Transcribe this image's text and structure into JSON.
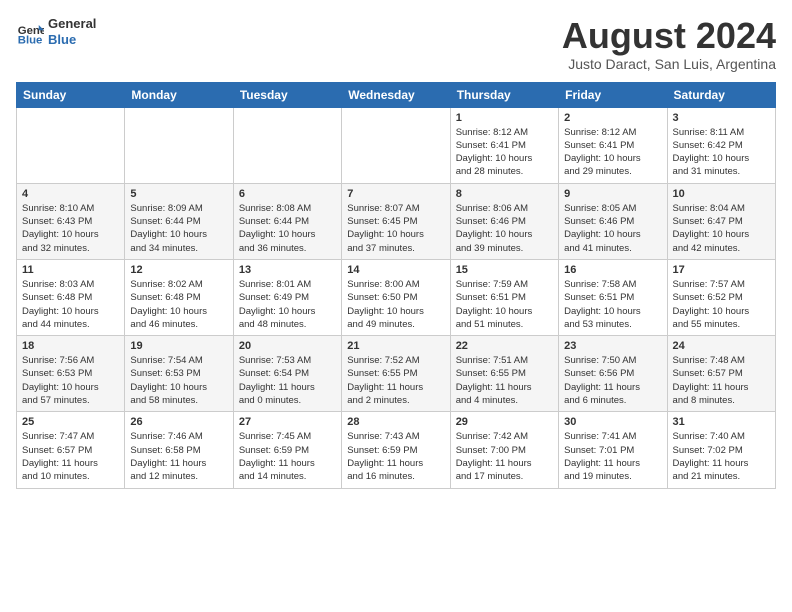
{
  "header": {
    "logo": {
      "line1": "General",
      "line2": "Blue"
    },
    "title": "August 2024",
    "location": "Justo Daract, San Luis, Argentina"
  },
  "weekdays": [
    "Sunday",
    "Monday",
    "Tuesday",
    "Wednesday",
    "Thursday",
    "Friday",
    "Saturday"
  ],
  "weeks": [
    [
      {
        "day": "",
        "info": ""
      },
      {
        "day": "",
        "info": ""
      },
      {
        "day": "",
        "info": ""
      },
      {
        "day": "",
        "info": ""
      },
      {
        "day": "1",
        "info": "Sunrise: 8:12 AM\nSunset: 6:41 PM\nDaylight: 10 hours\nand 28 minutes."
      },
      {
        "day": "2",
        "info": "Sunrise: 8:12 AM\nSunset: 6:41 PM\nDaylight: 10 hours\nand 29 minutes."
      },
      {
        "day": "3",
        "info": "Sunrise: 8:11 AM\nSunset: 6:42 PM\nDaylight: 10 hours\nand 31 minutes."
      }
    ],
    [
      {
        "day": "4",
        "info": "Sunrise: 8:10 AM\nSunset: 6:43 PM\nDaylight: 10 hours\nand 32 minutes."
      },
      {
        "day": "5",
        "info": "Sunrise: 8:09 AM\nSunset: 6:44 PM\nDaylight: 10 hours\nand 34 minutes."
      },
      {
        "day": "6",
        "info": "Sunrise: 8:08 AM\nSunset: 6:44 PM\nDaylight: 10 hours\nand 36 minutes."
      },
      {
        "day": "7",
        "info": "Sunrise: 8:07 AM\nSunset: 6:45 PM\nDaylight: 10 hours\nand 37 minutes."
      },
      {
        "day": "8",
        "info": "Sunrise: 8:06 AM\nSunset: 6:46 PM\nDaylight: 10 hours\nand 39 minutes."
      },
      {
        "day": "9",
        "info": "Sunrise: 8:05 AM\nSunset: 6:46 PM\nDaylight: 10 hours\nand 41 minutes."
      },
      {
        "day": "10",
        "info": "Sunrise: 8:04 AM\nSunset: 6:47 PM\nDaylight: 10 hours\nand 42 minutes."
      }
    ],
    [
      {
        "day": "11",
        "info": "Sunrise: 8:03 AM\nSunset: 6:48 PM\nDaylight: 10 hours\nand 44 minutes."
      },
      {
        "day": "12",
        "info": "Sunrise: 8:02 AM\nSunset: 6:48 PM\nDaylight: 10 hours\nand 46 minutes."
      },
      {
        "day": "13",
        "info": "Sunrise: 8:01 AM\nSunset: 6:49 PM\nDaylight: 10 hours\nand 48 minutes."
      },
      {
        "day": "14",
        "info": "Sunrise: 8:00 AM\nSunset: 6:50 PM\nDaylight: 10 hours\nand 49 minutes."
      },
      {
        "day": "15",
        "info": "Sunrise: 7:59 AM\nSunset: 6:51 PM\nDaylight: 10 hours\nand 51 minutes."
      },
      {
        "day": "16",
        "info": "Sunrise: 7:58 AM\nSunset: 6:51 PM\nDaylight: 10 hours\nand 53 minutes."
      },
      {
        "day": "17",
        "info": "Sunrise: 7:57 AM\nSunset: 6:52 PM\nDaylight: 10 hours\nand 55 minutes."
      }
    ],
    [
      {
        "day": "18",
        "info": "Sunrise: 7:56 AM\nSunset: 6:53 PM\nDaylight: 10 hours\nand 57 minutes."
      },
      {
        "day": "19",
        "info": "Sunrise: 7:54 AM\nSunset: 6:53 PM\nDaylight: 10 hours\nand 58 minutes."
      },
      {
        "day": "20",
        "info": "Sunrise: 7:53 AM\nSunset: 6:54 PM\nDaylight: 11 hours\nand 0 minutes."
      },
      {
        "day": "21",
        "info": "Sunrise: 7:52 AM\nSunset: 6:55 PM\nDaylight: 11 hours\nand 2 minutes."
      },
      {
        "day": "22",
        "info": "Sunrise: 7:51 AM\nSunset: 6:55 PM\nDaylight: 11 hours\nand 4 minutes."
      },
      {
        "day": "23",
        "info": "Sunrise: 7:50 AM\nSunset: 6:56 PM\nDaylight: 11 hours\nand 6 minutes."
      },
      {
        "day": "24",
        "info": "Sunrise: 7:48 AM\nSunset: 6:57 PM\nDaylight: 11 hours\nand 8 minutes."
      }
    ],
    [
      {
        "day": "25",
        "info": "Sunrise: 7:47 AM\nSunset: 6:57 PM\nDaylight: 11 hours\nand 10 minutes."
      },
      {
        "day": "26",
        "info": "Sunrise: 7:46 AM\nSunset: 6:58 PM\nDaylight: 11 hours\nand 12 minutes."
      },
      {
        "day": "27",
        "info": "Sunrise: 7:45 AM\nSunset: 6:59 PM\nDaylight: 11 hours\nand 14 minutes."
      },
      {
        "day": "28",
        "info": "Sunrise: 7:43 AM\nSunset: 6:59 PM\nDaylight: 11 hours\nand 16 minutes."
      },
      {
        "day": "29",
        "info": "Sunrise: 7:42 AM\nSunset: 7:00 PM\nDaylight: 11 hours\nand 17 minutes."
      },
      {
        "day": "30",
        "info": "Sunrise: 7:41 AM\nSunset: 7:01 PM\nDaylight: 11 hours\nand 19 minutes."
      },
      {
        "day": "31",
        "info": "Sunrise: 7:40 AM\nSunset: 7:02 PM\nDaylight: 11 hours\nand 21 minutes."
      }
    ]
  ]
}
